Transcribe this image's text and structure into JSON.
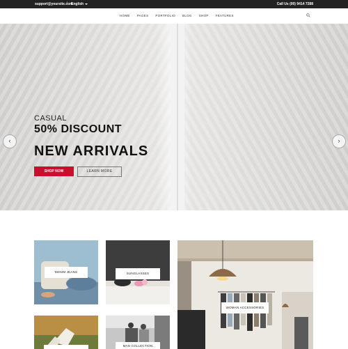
{
  "topbar": {
    "email": "support@yoursite.com",
    "separator": "|",
    "language": "English",
    "phone": "Call Us (00) 9414 7288"
  },
  "nav": {
    "items": [
      "HOME",
      "PAGES",
      "PORTFOLIO",
      "BLOG",
      "SHOP",
      "FEATURES"
    ],
    "search_icon": "search-icon"
  },
  "hero": {
    "eyebrow": "CASUAL",
    "headline": "50% DISCOUNT",
    "title": "NEW ARRIVALS",
    "primary_button": "SHOP NOW",
    "secondary_button": "LEARN MORE",
    "prev_icon": "chevron-left-icon",
    "next_icon": "chevron-right-icon",
    "prev_glyph": "‹",
    "next_glyph": "›",
    "slide_count": 2,
    "active_slide": 1
  },
  "categories": [
    {
      "label": "DENIM JEANS"
    },
    {
      "label": "SUNGLASSES"
    },
    {
      "label": "WOMAN ACCESSORIES"
    },
    {
      "label": ""
    },
    {
      "label": "MAN COLLECTION"
    }
  ],
  "colors": {
    "accent": "#c8102e",
    "topbar": "#222222"
  }
}
